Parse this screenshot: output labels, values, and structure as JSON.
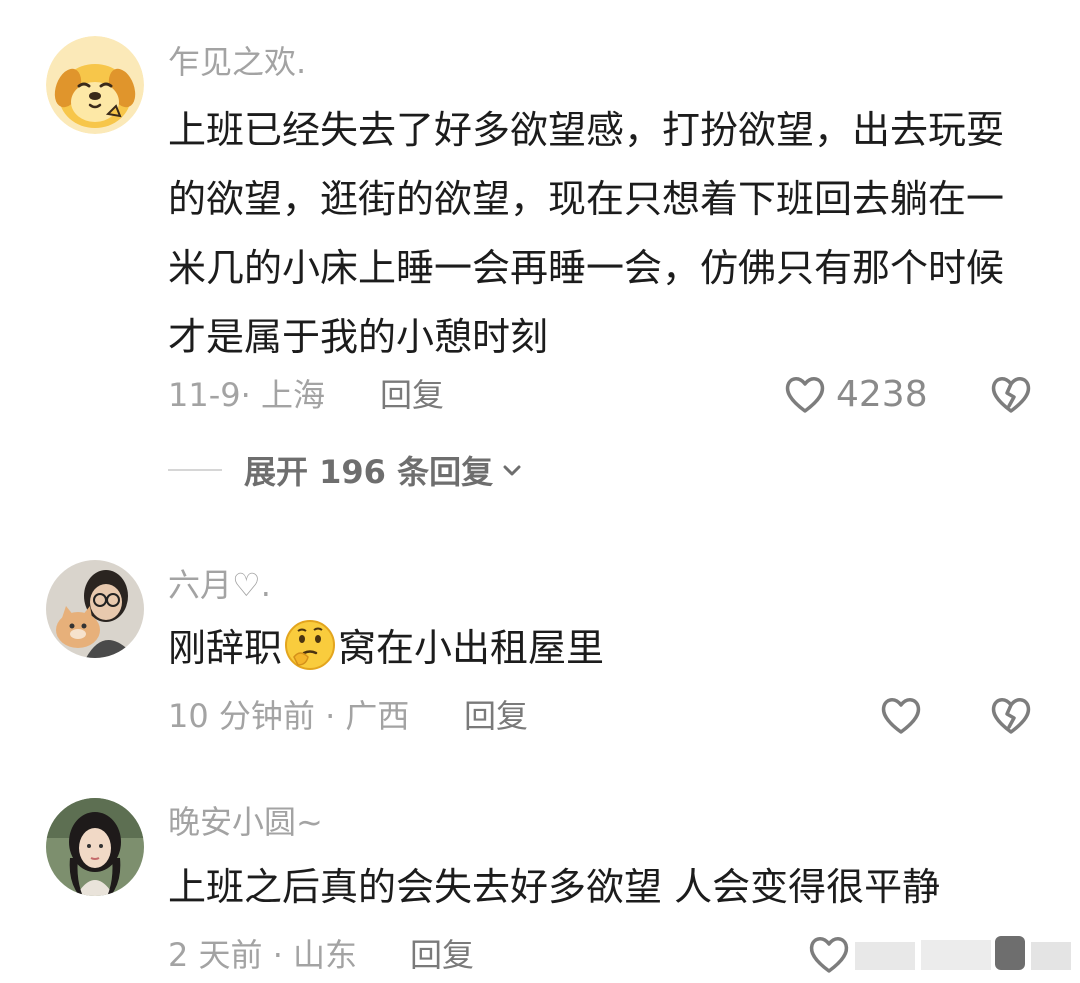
{
  "comments": [
    {
      "username": "乍见之欢.",
      "avatar_icon": "cartoon-dog-avatar",
      "text": "上班已经失去了好多欲望感，打扮欲望，出去玩耍的欲望，逛街的欲望，现在只想着下班回去躺在一米几的小床上睡一会再睡一会，仿佛只有那个时候才是属于我的小憩时刻",
      "meta": "11-9· 上海",
      "reply_label": "回复",
      "likes": "4238",
      "expand_label": "展开 196 条回复"
    },
    {
      "username": "六月♡.",
      "avatar_icon": "person-with-cat-avatar",
      "text_before": "刚辞职",
      "emoji": "thinking-face-emoji",
      "text_after": "窝在小出租屋里",
      "meta": "10 分钟前 · 广西",
      "reply_label": "回复"
    },
    {
      "username": "晚安小圆~",
      "avatar_icon": "girl-portrait-avatar",
      "text": "上班之后真的会失去好多欲望 人会变得很平静",
      "meta": "2 天前 · 山东",
      "reply_label": "回复"
    }
  ],
  "colors": {
    "secondary_text": "#a3a3a3",
    "reply_text": "#7a7a7a",
    "body_text": "#1c1c1c",
    "icon_stroke": "#7d7d7d"
  }
}
